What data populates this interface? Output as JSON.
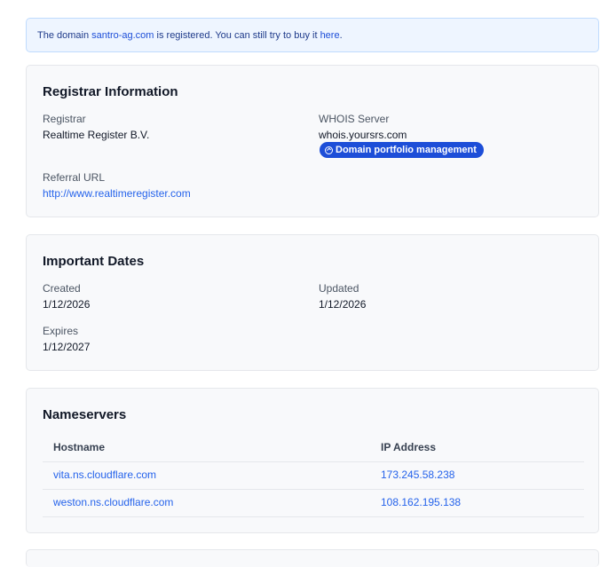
{
  "notice": {
    "prefix": "The domain ",
    "domain": "santro-ag.com",
    "middle": " is registered. You can still try to buy it ",
    "link": "here",
    "suffix": "."
  },
  "registrar": {
    "title": "Registrar Information",
    "registrar_label": "Registrar",
    "registrar_value": "Realtime Register B.V.",
    "whois_label": "WHOIS Server",
    "whois_value": "whois.yoursrs.com",
    "badge_label": "Domain portfolio management",
    "referral_label": "Referral URL",
    "referral_value": "http://www.realtimeregister.com"
  },
  "dates": {
    "title": "Important Dates",
    "created_label": "Created",
    "created_value": "1/12/2026",
    "updated_label": "Updated",
    "updated_value": "1/12/2026",
    "expires_label": "Expires",
    "expires_value": "1/12/2027"
  },
  "nameservers": {
    "title": "Nameservers",
    "columns": [
      "Hostname",
      "IP Address"
    ],
    "rows": [
      {
        "hostname": "vita.ns.cloudflare.com",
        "ip": "173.245.58.238"
      },
      {
        "hostname": "weston.ns.cloudflare.com",
        "ip": "108.162.195.138"
      }
    ]
  }
}
